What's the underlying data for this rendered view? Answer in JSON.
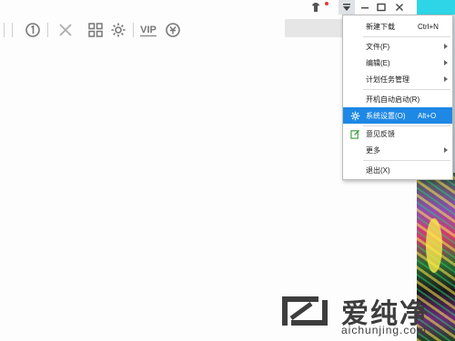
{
  "menu": {
    "items": [
      {
        "label": "新建下载",
        "shortcut": "Ctrl+N",
        "submenu": false,
        "icon": ""
      },
      {
        "label": "文件(F)",
        "shortcut": "",
        "submenu": true,
        "icon": ""
      },
      {
        "label": "编辑(E)",
        "shortcut": "",
        "submenu": true,
        "icon": ""
      },
      {
        "label": "计划任务管理",
        "shortcut": "",
        "submenu": true,
        "icon": ""
      },
      {
        "label": "开机自动启动(R)",
        "shortcut": "",
        "submenu": false,
        "icon": ""
      },
      {
        "label": "系统设置(O)",
        "shortcut": "Alt+O",
        "submenu": false,
        "icon": "gear-icon",
        "highlighted": true
      },
      {
        "label": "意见反馈",
        "shortcut": "",
        "submenu": false,
        "icon": "feedback-edit-icon"
      },
      {
        "label": "更多",
        "shortcut": "",
        "submenu": true,
        "icon": ""
      },
      {
        "label": "退出(X)",
        "shortcut": "",
        "submenu": false,
        "icon": ""
      }
    ]
  },
  "toolbar": {
    "vip_label": "VIP",
    "icons": [
      "priority-1-icon",
      "delete-x-icon",
      "grid-icon",
      "settings-gear-icon",
      "vip-icon",
      "coupon-icon"
    ]
  },
  "titlebar": {
    "icons": [
      "skin-icon",
      "menu-dropdown-icon",
      "minimize-icon",
      "maximize-icon",
      "close-icon"
    ]
  },
  "watermark": {
    "brand": "爱纯净",
    "url": "aichunjing.com"
  },
  "colors": {
    "highlight": "#1e88e5",
    "feedback_icon": "#43a047",
    "notify_dot": "#e53935"
  }
}
